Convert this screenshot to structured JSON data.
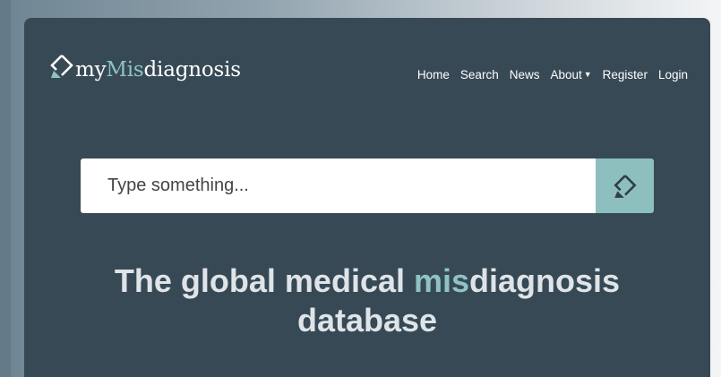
{
  "brand": {
    "prefix": "my",
    "accent": "Mis",
    "suffix": "diagnosis",
    "logo_icon": "diamond-arrow-icon"
  },
  "nav": {
    "home": "Home",
    "search": "Search",
    "news": "News",
    "about": "About",
    "register": "Register",
    "login": "Login"
  },
  "search": {
    "placeholder": "Type something...",
    "button_icon": "diamond-arrow-icon"
  },
  "hero": {
    "headline_before": "The global medical ",
    "headline_accent": "mis",
    "headline_after": "diagnosis",
    "headline_line2": "database"
  },
  "colors": {
    "panel": "#374955",
    "accent": "#8ec3c2",
    "search_button": "#8dbfbf",
    "headline": "#dfe4e8"
  }
}
